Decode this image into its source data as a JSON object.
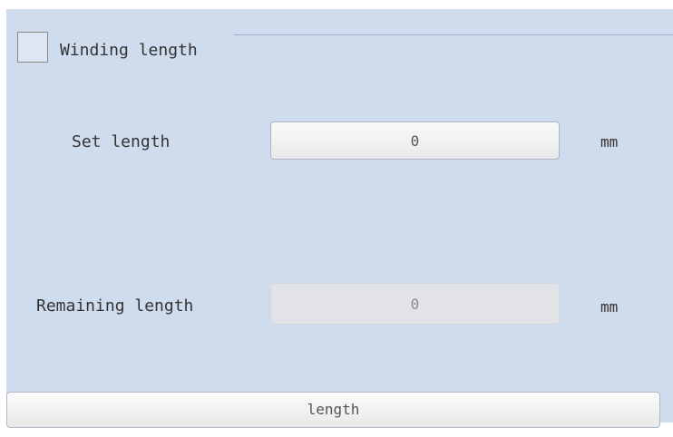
{
  "group": {
    "title": "Winding length",
    "checked": false
  },
  "set_length": {
    "label": "Set length",
    "value": "0",
    "unit": "mm"
  },
  "remaining_length": {
    "label": "Remaining length",
    "value": "0",
    "unit": "mm"
  },
  "button": {
    "label": "length"
  }
}
